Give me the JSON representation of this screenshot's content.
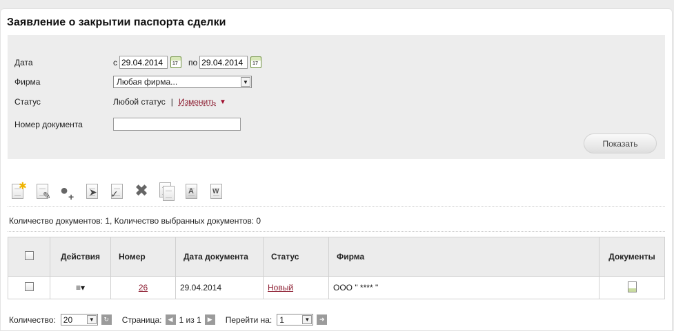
{
  "title": "Заявление о закрытии паспорта сделки",
  "filter": {
    "date_label": "Дата",
    "from_label": "с",
    "from_value": "29.04.2014",
    "to_label": "по",
    "to_value": "29.04.2014",
    "calendar_day": "17",
    "firm_label": "Фирма",
    "firm_value": "Любая фирма...",
    "status_label": "Статус",
    "status_value": "Любой статус",
    "status_separator": "|",
    "status_change": "Изменить",
    "status_change_arrow": "▼",
    "docnum_label": "Номер документа",
    "docnum_value": "",
    "show_button": "Показать"
  },
  "toolbar": {
    "icons": [
      "new-document-icon",
      "edit-document-icon",
      "assign-user-icon",
      "sign-document-icon",
      "check-document-icon",
      "delete-icon",
      "copy-document-icon",
      "export-pdf-icon",
      "export-word-icon"
    ]
  },
  "summary": "Количество документов: 1, Количество выбранных документов: 0",
  "table": {
    "headers": {
      "actions": "Действия",
      "number": "Номер",
      "date": "Дата документа",
      "status": "Статус",
      "firm": "Фирма",
      "documents": "Документы"
    },
    "rows": [
      {
        "actions_icon": "≡▾",
        "number": "26",
        "date": "29.04.2014",
        "status": "Новый",
        "firm": "ООО \" **** \"",
        "doc_icon": "document-icon"
      }
    ]
  },
  "pager": {
    "count_label": "Количество:",
    "count_value": "20",
    "page_label": "Страница:",
    "page_value": "1 из 1",
    "goto_label": "Перейти на:",
    "goto_value": "1"
  },
  "colors": {
    "link": "#8b1a2e",
    "filter_bg": "#ededed",
    "header_bg": "#ececec"
  }
}
